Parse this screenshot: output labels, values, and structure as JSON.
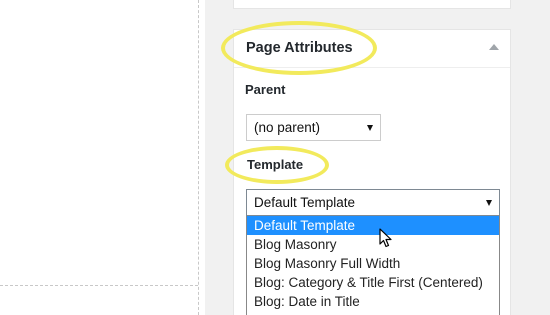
{
  "metabox": {
    "title": "Page Attributes"
  },
  "parent": {
    "label": "Parent",
    "selected": "(no parent)"
  },
  "template": {
    "label": "Template",
    "selected": "Default Template",
    "options": [
      "Default Template",
      "Blog Masonry",
      "Blog Masonry Full Width",
      "Blog: Category & Title First (Centered)",
      "Blog: Date in Title"
    ],
    "highlighted_index": 0
  },
  "colors": {
    "highlight": "#f2ea5c",
    "selection": "#1e90ff"
  }
}
